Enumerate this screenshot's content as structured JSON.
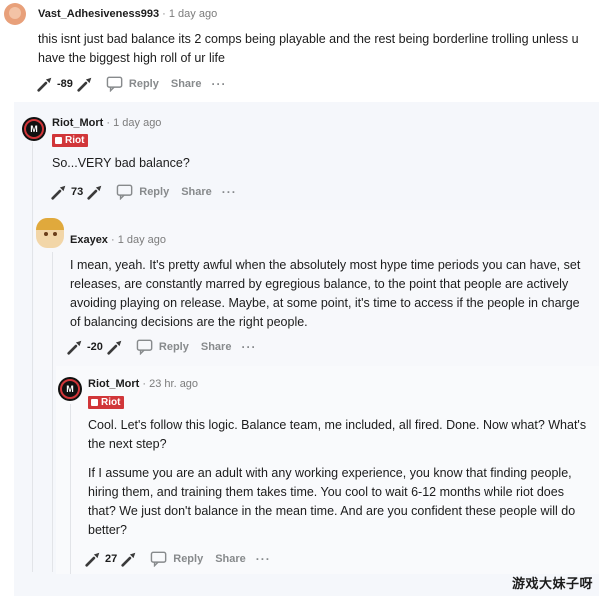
{
  "comments": [
    {
      "username": "Vast_Adhesiveness993",
      "time": "· 1 day ago",
      "flair": null,
      "body": [
        "this isnt just bad balance its 2 comps being playable and the rest being borderline trolling unless u have the biggest high roll of ur life"
      ],
      "score": "-89",
      "reply_label": "Reply",
      "share_label": "Share",
      "more_label": "···"
    },
    {
      "username": "Riot_Mort",
      "time": "· 1 day ago",
      "flair": "Riot",
      "body": [
        "So...VERY bad balance?"
      ],
      "score": "73",
      "reply_label": "Reply",
      "share_label": "Share",
      "more_label": "···"
    },
    {
      "username": "Exayex",
      "time": "· 1 day ago",
      "flair": null,
      "body": [
        "I mean, yeah. It's pretty awful when the absolutely most hype time periods you can have, set releases, are constantly marred by egregious balance, to the point that people are actively avoiding playing on release. Maybe, at some point, it's time to access if the people in charge of balancing decisions are the right people."
      ],
      "score": "-20",
      "reply_label": "Reply",
      "share_label": "Share",
      "more_label": "···"
    },
    {
      "username": "Riot_Mort",
      "time": "· 23 hr. ago",
      "flair": "Riot",
      "body": [
        "Cool. Let's follow this logic. Balance team, me included, all fired. Done. Now what? What's the next step?",
        "If I assume you are an adult with any working experience, you know that finding people, hiring them, and training them takes time. You cool to wait 6-12 months while riot does that? We just don't balance in the mean time. And are you confident these people will do better?"
      ],
      "score": "27",
      "reply_label": "Reply",
      "share_label": "Share",
      "more_label": "···"
    }
  ],
  "watermark": "游戏大妹子呀",
  "colors": {
    "riot_flair": "#d13639",
    "panel_bg": "#f5f7fb",
    "meta_gray": "#7c7c7c",
    "action_gray": "#878a8c"
  },
  "icons": {
    "upvote": "upvote-arrow-icon",
    "downvote": "downvote-arrow-icon",
    "reply": "comment-bubble-icon",
    "riot_avatar": "riot-logo-avatar",
    "exayex_avatar": "anime-character-avatar",
    "vast_avatar": "orange-avatar"
  }
}
